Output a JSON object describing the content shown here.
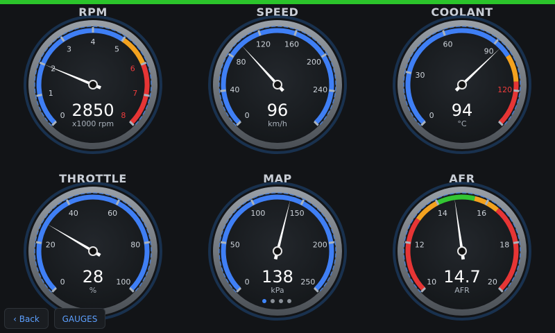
{
  "colors": {
    "accent": "#2bc42b",
    "arc_blue": "#3f7ff5",
    "arc_orange": "#f3a21f",
    "arc_red": "#e63535",
    "arc_green": "#33c633",
    "needle": "#ffffff",
    "dot_active": "#3f86ff"
  },
  "gauges": [
    {
      "title": "RPM",
      "value": 2850,
      "value_text": "2850",
      "unit": "x1000 rpm",
      "min": 0,
      "max": 8,
      "ticks": [
        {
          "label": "0"
        },
        {
          "label": "1"
        },
        {
          "label": "2"
        },
        {
          "label": "3"
        },
        {
          "label": "4"
        },
        {
          "label": "5"
        },
        {
          "label": "6",
          "red": true
        },
        {
          "label": "7",
          "red": true
        },
        {
          "label": "8",
          "red": true
        }
      ],
      "bands": [
        {
          "from": 0,
          "to": 5,
          "color": "#3f7ff5"
        },
        {
          "from": 5,
          "to": 6,
          "color": "#f3a21f"
        },
        {
          "from": 6,
          "to": 8,
          "color": "#e63535"
        }
      ]
    },
    {
      "title": "SPEED",
      "value": 96,
      "value_text": "96",
      "unit": "km/h",
      "min": 0,
      "max": 280,
      "ticks": [
        {
          "label": "0"
        },
        {
          "label": "40"
        },
        {
          "label": "80"
        },
        {
          "label": "120"
        },
        {
          "label": "160"
        },
        {
          "label": "200"
        },
        {
          "label": "240"
        },
        {
          "label": ""
        }
      ],
      "bands": [
        {
          "from": 0,
          "to": 280,
          "color": "#3f7ff5"
        }
      ]
    },
    {
      "title": "COOLANT",
      "value": 94,
      "value_text": "94",
      "unit": "°C",
      "min": 0,
      "max": 140,
      "ticks": [
        {
          "label": "0"
        },
        {
          "label": "30"
        },
        {
          "label": "60"
        },
        {
          "label": "90"
        },
        {
          "label": "120",
          "red": true
        },
        {
          "label": ""
        }
      ],
      "tick_values": [
        0,
        30,
        60,
        90,
        120,
        140
      ],
      "bands": [
        {
          "from": 0,
          "to": 100,
          "color": "#3f7ff5"
        },
        {
          "from": 100,
          "to": 115,
          "color": "#f3a21f"
        },
        {
          "from": 115,
          "to": 140,
          "color": "#e63535"
        }
      ]
    },
    {
      "title": "THROTTLE",
      "value": 28,
      "value_text": "28",
      "unit": "%",
      "min": 0,
      "max": 100,
      "ticks": [
        {
          "label": "0"
        },
        {
          "label": "20"
        },
        {
          "label": "40"
        },
        {
          "label": "60"
        },
        {
          "label": "80"
        },
        {
          "label": "100"
        }
      ],
      "bands": [
        {
          "from": 0,
          "to": 100,
          "color": "#3f7ff5"
        }
      ]
    },
    {
      "title": "MAP",
      "value": 138,
      "value_text": "138",
      "unit": "kPa",
      "min": 0,
      "max": 250,
      "ticks": [
        {
          "label": "0"
        },
        {
          "label": "50"
        },
        {
          "label": "100"
        },
        {
          "label": "150"
        },
        {
          "label": "200"
        },
        {
          "label": "250"
        }
      ],
      "bands": [
        {
          "from": 0,
          "to": 250,
          "color": "#3f7ff5"
        }
      ]
    },
    {
      "title": "AFR",
      "value": 14.7,
      "value_text": "14.7",
      "unit": "AFR",
      "min": 10,
      "max": 20,
      "ticks": [
        {
          "label": "10"
        },
        {
          "label": "12"
        },
        {
          "label": "14"
        },
        {
          "label": "16"
        },
        {
          "label": "18"
        },
        {
          "label": "20"
        }
      ],
      "bands": [
        {
          "from": 10,
          "to": 13,
          "color": "#e63535"
        },
        {
          "from": 13,
          "to": 14,
          "color": "#f3a21f"
        },
        {
          "from": 14,
          "to": 15.5,
          "color": "#33c633"
        },
        {
          "from": 15.5,
          "to": 16.5,
          "color": "#f3a21f"
        },
        {
          "from": 16.5,
          "to": 20,
          "color": "#e63535"
        }
      ]
    }
  ],
  "pager": {
    "count": 4,
    "active_index": 0
  },
  "nav": {
    "back_label": "‹ Back",
    "gauges_label": "GAUGES"
  }
}
